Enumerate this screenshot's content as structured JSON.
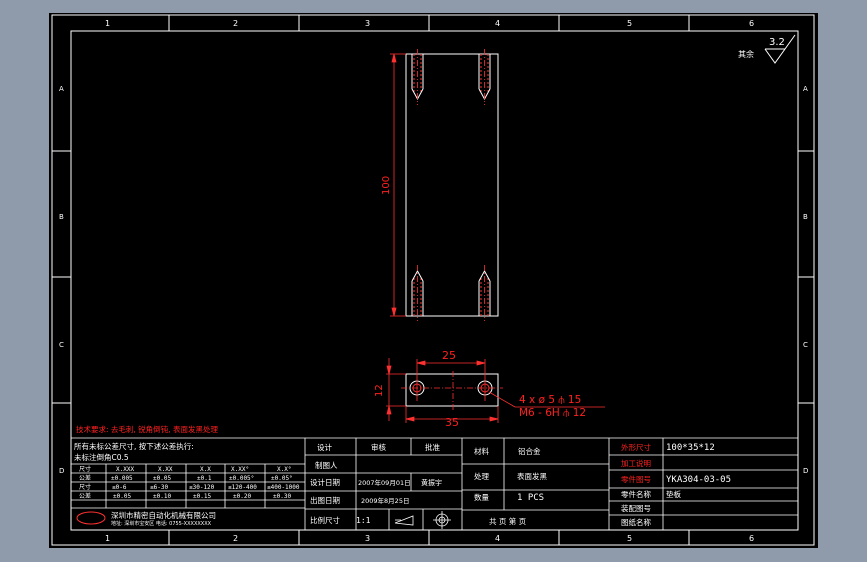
{
  "zone_columns": [
    "1",
    "2",
    "3",
    "4",
    "5",
    "6"
  ],
  "zone_rows": [
    "A",
    "B",
    "C",
    "D"
  ],
  "roughness": {
    "label": "其余",
    "value": "3.2"
  },
  "drawing": {
    "front_view": {
      "height_dim": "100"
    },
    "top_view": {
      "hole_spacing_dim": "25",
      "width_dim": "35",
      "thickness_dim": "12",
      "hole_callout_line1": "4 x ø 5 ⫛ 15",
      "hole_callout_line2": "M6 - 6H ⫛ 12"
    }
  },
  "notes": {
    "heading": "技术要求: 去毛刺, 锐角倒钝, 表面发黑处理"
  },
  "tolerance_table": {
    "intro_line1": "所有未标公差尺寸, 按下述公差执行:",
    "intro_line2": "未标注倒角C0.5",
    "headers": [
      "尺寸",
      "X.XXX",
      "X.XX",
      "X.X",
      "X.XX°",
      "X.X°"
    ],
    "rows": [
      [
        "公差",
        "±0.005",
        "±0.05",
        "±0.1",
        "±0.005°",
        "±0.05°"
      ],
      [
        "尺寸",
        "≤0-6",
        "≤6-30",
        "≤30-120",
        "≤120-400",
        "≤400-1000"
      ],
      [
        "公差",
        "±0.05",
        "±0.10",
        "±0.15",
        "±0.20",
        "±0.30"
      ]
    ]
  },
  "company": {
    "name": "深圳市精密自动化机械有限公司",
    "sub": "地址: 深圳市宝安区 电话: 0755-XXXXXXXX"
  },
  "approval": {
    "labels": [
      "设计",
      "审核",
      "批准",
      "制图人",
      "设计日期",
      "出图日期",
      "比例尺寸"
    ],
    "design_date": "2007年09月01日",
    "designer": "黄振宇",
    "print_date": "2009年8月25日",
    "scale": "1:1"
  },
  "part_info": {
    "material_label": "材料",
    "material": "铝合金",
    "surface_label": "处理",
    "surface": "表面发黑",
    "qty_label": "数量",
    "qty": "1 PCS",
    "page_label": "共   页   第   页"
  },
  "title_block": {
    "size_label": "外形尺寸",
    "size": "100*35*12",
    "process_label": "加工说明",
    "process": "",
    "part_no_label": "零件图号",
    "part_no": "YKA304-03-05",
    "part_name_label": "零件名称",
    "part_name": "垫板",
    "assembly_label": "装配图号",
    "assembly": "",
    "drawing_name_label": "图纸名称",
    "drawing_name": ""
  }
}
